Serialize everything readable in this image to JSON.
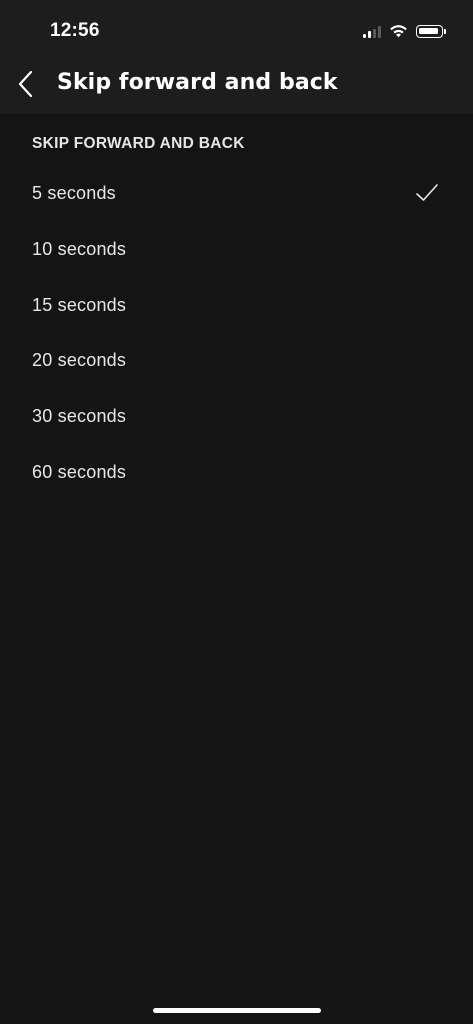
{
  "status_bar": {
    "time": "12:56",
    "icons": [
      "cellular-signal-icon",
      "wifi-icon",
      "battery-icon"
    ]
  },
  "nav": {
    "back_icon": "chevron-left-icon",
    "title": "Skip forward and back"
  },
  "section": {
    "header": "SKIP FORWARD AND BACK"
  },
  "options": [
    {
      "label": "5 seconds",
      "selected": true
    },
    {
      "label": "10 seconds",
      "selected": false
    },
    {
      "label": "15 seconds",
      "selected": false
    },
    {
      "label": "20 seconds",
      "selected": false
    },
    {
      "label": "30 seconds",
      "selected": false
    },
    {
      "label": "60 seconds",
      "selected": false
    }
  ],
  "selected_icon": "checkmark-icon",
  "colors": {
    "background": "#141414",
    "header_background": "#1d1d1d",
    "text": "#e8e8e8",
    "accent": "#ffffff"
  }
}
